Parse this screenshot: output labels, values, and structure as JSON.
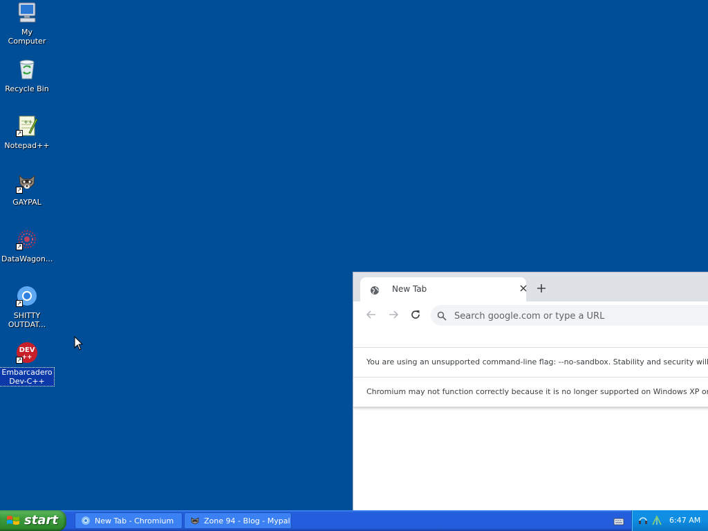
{
  "desktop": {
    "icons": [
      {
        "label": "My Computer",
        "icon": "my-computer-icon"
      },
      {
        "label": "Recycle Bin",
        "icon": "recycle-bin-icon"
      },
      {
        "label": "Notepad++",
        "icon": "notepad-plus-plus-icon"
      },
      {
        "label": "GAYPAL",
        "icon": "raccoon-icon"
      },
      {
        "label": "DataWagon...",
        "icon": "datawagon-icon"
      },
      {
        "label": "SHITTY\nOUTDAT...",
        "icon": "chromium-icon"
      },
      {
        "label": "Embarcadero\nDev-C++",
        "icon": "dev-cpp-icon",
        "selected": true,
        "badge": "DEV\n++"
      }
    ]
  },
  "browser": {
    "tab_title": "New Tab",
    "omnibox_placeholder": "Search google.com or type a URL",
    "infobars": [
      "You are using an unsupported command-line flag: --no-sandbox. Stability and security will suffer.",
      "Chromium may not function correctly because it is no longer supported on Windows XP or Windows Vista."
    ]
  },
  "taskbar": {
    "start_label": "start",
    "tasks": [
      {
        "label": "New Tab - Chromium",
        "icon": "chromium-icon"
      },
      {
        "label": "Zone 94 - Blog - Mypal",
        "icon": "mypal-icon"
      }
    ],
    "clock": "6:47 AM"
  },
  "colors": {
    "desktop": "#004e98",
    "taskbar": "#245edc",
    "start": "#3c9a3c",
    "tray": "#0f8de0"
  }
}
